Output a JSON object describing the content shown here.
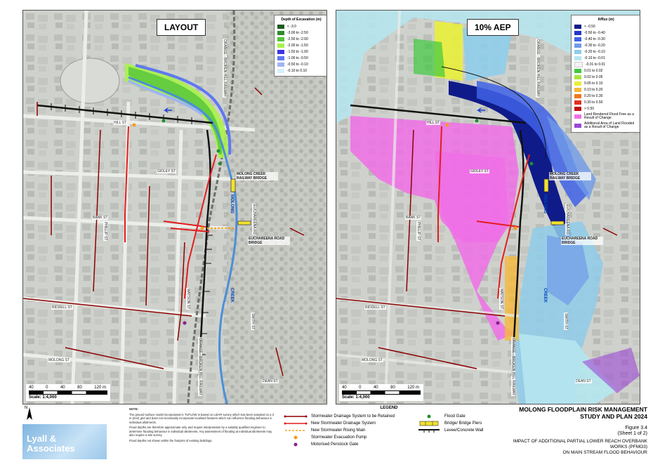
{
  "layout_panel": {
    "title": "LAYOUT",
    "legend_title": "Depth of Excavation (m)",
    "legend_items": [
      {
        "label": "< -3.0",
        "color": "#1e5b1e"
      },
      {
        "label": "-3.00 to -2.50",
        "color": "#2f8a2f"
      },
      {
        "label": "-2.50 to -2.00",
        "color": "#54c43a"
      },
      {
        "label": "-2.00 to -1.50",
        "color": "#a8f24a"
      },
      {
        "label": "-1.50 to -1.00",
        "color": "#3d35e0"
      },
      {
        "label": "-1.00 to -0.50",
        "color": "#5f78f0"
      },
      {
        "label": "-0.50 to -0.10",
        "color": "#9fb4f6"
      },
      {
        "label": "-0.10 to 0.10",
        "color": "#d6f0fb"
      }
    ]
  },
  "aep_panel": {
    "title": "10% AEP",
    "legend_title": "Afflux (m)",
    "legend_items": [
      {
        "label": "< -0.50",
        "color": "#101b8a"
      },
      {
        "label": "-0.50 to -0.40",
        "color": "#2436c9"
      },
      {
        "label": "-0.40 to -0.30",
        "color": "#3f62e6"
      },
      {
        "label": "-0.30 to -0.20",
        "color": "#6f9be8"
      },
      {
        "label": "-0.20 to -0.10",
        "color": "#8fcdea"
      },
      {
        "label": "-0.10 to -0.01",
        "color": "#b5e6ef"
      },
      {
        "label": "-0.01 to 0.01",
        "color": "#f2f2f2"
      },
      {
        "label": "0.01 to 0.02",
        "color": "#3ec93e"
      },
      {
        "label": "0.02 to 0.05",
        "color": "#a6e63e"
      },
      {
        "label": "0.05 to 0.10",
        "color": "#e9ef3a"
      },
      {
        "label": "0.10 to 0.20",
        "color": "#f6b93a"
      },
      {
        "label": "0.20 to 0.30",
        "color": "#f0781e"
      },
      {
        "label": "0.30 to 0.50",
        "color": "#e0301e"
      },
      {
        "label": "> 0.50",
        "color": "#c21010"
      },
      {
        "label": "Land Rendered Flood Free as a Result of Change",
        "color": "#f06fe6"
      },
      {
        "label": "Additional Area of Land Flooded as a Result of Change",
        "color": "#9c48d6"
      }
    ]
  },
  "map_labels": {
    "bridge_rail": "MOLONG CREEK RAILWAY BRIDGE",
    "bridge_road": "EUCHAREENA ROAD BRIDGE",
    "railway_top": "ORANGE - BROKEN HILL RAILWAY",
    "railway_bottom": "ORANGE - BROKEN HILL RAILWAY",
    "creek_north": "MOLONG",
    "creek_south": "CREEK",
    "streets": [
      "HILL ST",
      "GIDLEY ST",
      "BANK ST",
      "RIDDELL ST",
      "MOLONG ST",
      "DEAN ST",
      "SMITH ST",
      "EUCHAREENA RD",
      "WATSON ST",
      "PHILLIP ST"
    ]
  },
  "scale": {
    "ticks": [
      "40",
      "0",
      "40",
      "80",
      "120 m"
    ],
    "text": "Scale: 1:4,000"
  },
  "north": "N",
  "logo": {
    "line1": "Lyall &",
    "line2": "Associates"
  },
  "note": {
    "heading": "NOTE:",
    "p1": "The ground surface model incorporated in TUFLOW is based on LiDAR survey which has been sampled on a 3 m (mm) grid and does not necessarily incorporate localised features which can influence flooding behaviour in individual allotments.",
    "p2": "Flood depths are therefore approximate only and require interpretation by a suitably qualified engineer to determine flooding behaviour in individual allotments. Any assessment of flooding at individual allotments may also require a site survey.",
    "p3": "Flood depths not shown within the footprint of existing buildings."
  },
  "legend": {
    "heading": "LEGEND",
    "items_left": [
      {
        "label": "Stormwater Drainage System to be Retained",
        "symbol": "dark-red-line"
      },
      {
        "label": "New Stormwater Drainage System",
        "symbol": "red-line"
      },
      {
        "label": "New Stormwater Rising Main",
        "symbol": "orange-dash"
      },
      {
        "label": "Stormwater Evacuation Pump",
        "symbol": "orange-dot"
      },
      {
        "label": "Motorised Penstock Gate",
        "symbol": "purple-dot"
      }
    ],
    "items_right": [
      {
        "label": "Flood Gate",
        "symbol": "green-dot"
      },
      {
        "label": "Bridge/ Bridge Piers",
        "symbol": "yellow-bar"
      },
      {
        "label": "Levee/Concrete Wall",
        "symbol": "black-line"
      }
    ]
  },
  "title_block": {
    "line1": "MOLONG FLOODPLAIN RISK MANAGEMENT",
    "line2": "STUDY AND PLAN 2024",
    "figure": "Figure 3.4",
    "sheet": "(Sheet 1 of 2)",
    "desc1": "IMPACT OF ADDITIONAL PARTIAL LOWER REACH OVERBANK WORKS (PFMO3)",
    "desc2": "ON MAIN STREAM FLOOD BEHAVIOUR"
  }
}
